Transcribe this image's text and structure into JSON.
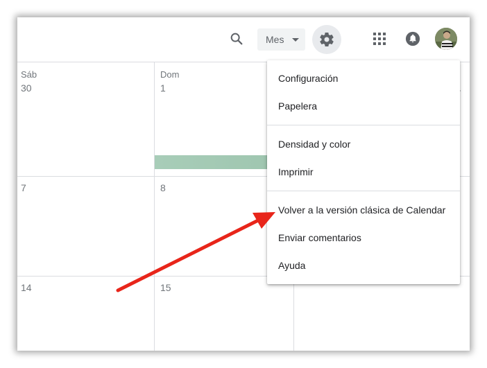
{
  "toolbar": {
    "view_select_label": "Mes",
    "icons": [
      "search-icon",
      "chevron-down-icon",
      "gear-icon",
      "apps-grid-icon",
      "notifications-icon",
      "avatar"
    ]
  },
  "calendar": {
    "days": [
      {
        "weekday": "Sáb",
        "date": "30"
      },
      {
        "weekday": "Dom",
        "date": "1"
      }
    ],
    "row2": {
      "col1": "7",
      "col2": "8"
    },
    "row3": {
      "col1": "14",
      "col2": "15"
    },
    "event_color": "#a8cdb8"
  },
  "menu": {
    "group1": [
      "Configuración",
      "Papelera"
    ],
    "group2": [
      "Densidad y color",
      "Imprimir"
    ],
    "group3": [
      "Volver a la versión clásica de Calendar",
      "Enviar comentarios",
      "Ayuda"
    ]
  },
  "colors": {
    "annotation_arrow": "#e8251a",
    "gear_highlight": "#e8eaed",
    "select_bg": "#f1f3f4"
  }
}
